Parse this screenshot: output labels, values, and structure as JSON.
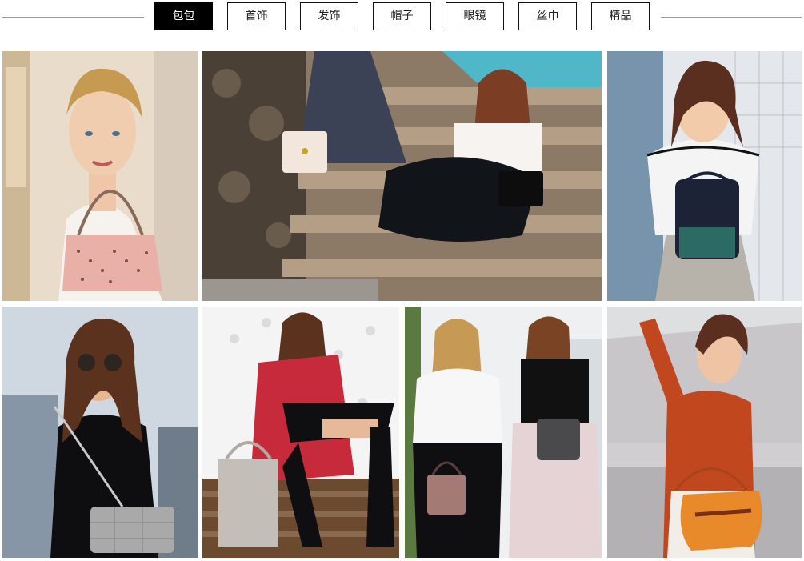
{
  "category_tabs": [
    {
      "label": "包包",
      "active": true
    },
    {
      "label": "首饰",
      "active": false
    },
    {
      "label": "发饰",
      "active": false
    },
    {
      "label": "帽子",
      "active": false
    },
    {
      "label": "眼镜",
      "active": false
    },
    {
      "label": "丝巾",
      "active": false
    },
    {
      "label": "精品",
      "active": false
    }
  ],
  "colors": {
    "active_tab_bg": "#000000",
    "tab_border": "#111111",
    "divider": "#9a9a9a",
    "page_bg": "#ffffff"
  },
  "gallery": [
    {
      "subject": "pink perforated bucket bag, white camisole",
      "bag_color": "#e8b0a6"
    },
    {
      "subject": "two models on wooden steps, pleated skirts, cream and black handbags",
      "bag_color": "#f2e6dd"
    },
    {
      "subject": "navy mini backpack, white tee with black trim",
      "bag_color": "#1d2336"
    },
    {
      "subject": "quilted tweed chain shoulder bag, black strapless dress",
      "bag_color": "#a9a9a9"
    },
    {
      "subject": "grey tote, red coat and black dress, seated",
      "bag_color": "#c4beb8"
    },
    {
      "subject": "two models, pink and grey top-handle bags",
      "bag_color": "#a37b74"
    },
    {
      "subject": "orange saddle bag, rust sweater on grey sofa",
      "bag_color": "#e88a2a"
    }
  ]
}
